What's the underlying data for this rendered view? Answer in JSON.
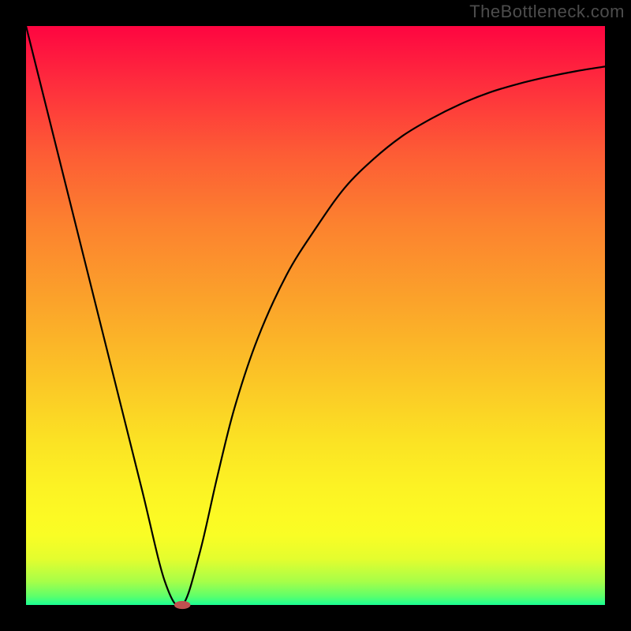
{
  "watermark": "TheBottleneck.com",
  "chart_data": {
    "type": "line",
    "title": "",
    "xlabel": "",
    "ylabel": "",
    "xlim": [
      0,
      100
    ],
    "ylim": [
      0,
      100
    ],
    "grid": false,
    "legend": false,
    "background_gradient": {
      "orientation": "vertical",
      "stops": [
        {
          "pos": 0.0,
          "color": "#fe0541"
        },
        {
          "pos": 0.5,
          "color": "#fbb028"
        },
        {
          "pos": 0.85,
          "color": "#fcfa24"
        },
        {
          "pos": 1.0,
          "color": "#1aff94"
        }
      ]
    },
    "series": [
      {
        "name": "bottleneck-curve",
        "color": "#000000",
        "x": [
          0,
          5,
          10,
          15,
          20,
          24,
          27,
          30,
          33,
          36,
          40,
          45,
          50,
          55,
          60,
          65,
          70,
          75,
          80,
          85,
          90,
          95,
          100
        ],
        "y": [
          100,
          80,
          60,
          40,
          20,
          4,
          0,
          9,
          22,
          34,
          46,
          57,
          65,
          72,
          77,
          81,
          84,
          86.5,
          88.5,
          90,
          91.2,
          92.2,
          93
        ]
      }
    ],
    "marker": {
      "name": "optimal-point",
      "x": 27,
      "y": 0,
      "shape": "pill",
      "color": "#c05050",
      "width_frac": 0.028,
      "height_frac": 0.014
    },
    "notes": "y-values are approximate, read visually from the plotted curve; axes have no tick labels."
  }
}
